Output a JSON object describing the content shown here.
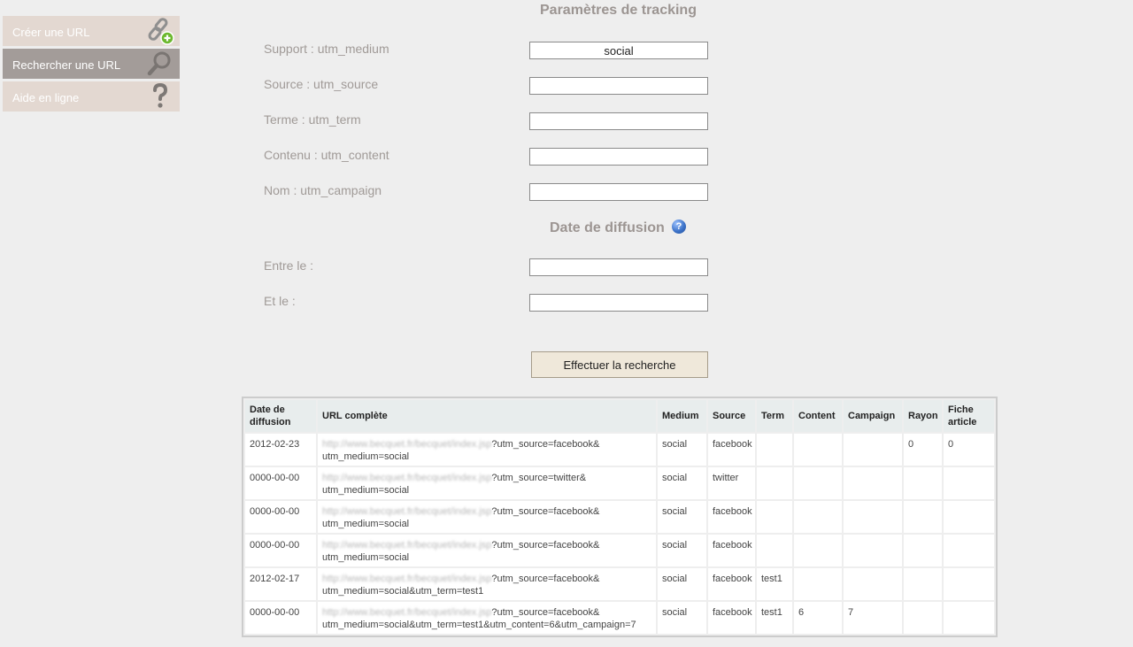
{
  "sidebar": {
    "items": [
      {
        "label": "Créer une URL",
        "icon": "link-add-icon"
      },
      {
        "label": "Rechercher une URL",
        "icon": "magnifier-icon"
      },
      {
        "label": "Aide en ligne",
        "icon": "question-icon"
      }
    ]
  },
  "tracking": {
    "title": "Paramètres de tracking",
    "fields": [
      {
        "label": "Support : utm_medium",
        "value": "social"
      },
      {
        "label": "Source : utm_source",
        "value": ""
      },
      {
        "label": "Terme : utm_term",
        "value": ""
      },
      {
        "label": "Contenu : utm_content",
        "value": ""
      },
      {
        "label": "Nom : utm_campaign",
        "value": ""
      }
    ]
  },
  "date": {
    "title": "Date de diffusion",
    "help_symbol": "?",
    "fields": [
      {
        "label": "Entre le :",
        "value": ""
      },
      {
        "label": "Et le :",
        "value": ""
      }
    ]
  },
  "search_button": "Effectuer la recherche",
  "table": {
    "headers": [
      "Date de diffusion",
      "URL complète",
      "Medium",
      "Source",
      "Term",
      "Content",
      "Campaign",
      "Rayon",
      "Fiche article"
    ],
    "rows": [
      {
        "date": "2012-02-23",
        "url_host": "http://www.becquet.fr/becquet/index.jsp",
        "url_query": "?utm_source=facebook&",
        "url_line2": "utm_medium=social",
        "medium": "social",
        "source": "facebook",
        "term": "",
        "content": "",
        "campaign": "",
        "rayon": "0",
        "fiche": "0"
      },
      {
        "date": "0000-00-00",
        "url_host": "http://www.becquet.fr/becquet/index.jsp",
        "url_query": "?utm_source=twitter&",
        "url_line2": "utm_medium=social",
        "medium": "social",
        "source": "twitter",
        "term": "",
        "content": "",
        "campaign": "",
        "rayon": "",
        "fiche": ""
      },
      {
        "date": "0000-00-00",
        "url_host": "http://www.becquet.fr/becquet/index.jsp",
        "url_query": "?utm_source=facebook&",
        "url_line2": "utm_medium=social",
        "medium": "social",
        "source": "facebook",
        "term": "",
        "content": "",
        "campaign": "",
        "rayon": "",
        "fiche": ""
      },
      {
        "date": "0000-00-00",
        "url_host": "http://www.becquet.fr/becquet/index.jsp",
        "url_query": "?utm_source=facebook&",
        "url_line2": "utm_medium=social",
        "medium": "social",
        "source": "facebook",
        "term": "",
        "content": "",
        "campaign": "",
        "rayon": "",
        "fiche": ""
      },
      {
        "date": "2012-02-17",
        "url_host": "http://www.becquet.fr/becquet/index.jsp",
        "url_query": "?utm_source=facebook&",
        "url_line2": "utm_medium=social&utm_term=test1",
        "medium": "social",
        "source": "facebook",
        "term": "test1",
        "content": "",
        "campaign": "",
        "rayon": "",
        "fiche": ""
      },
      {
        "date": "0000-00-00",
        "url_host": "http://www.becquet.fr/becquet/index.jsp",
        "url_query": "?utm_source=facebook&",
        "url_line2": "utm_medium=social&utm_term=test1&utm_content=6&utm_campaign=7",
        "medium": "social",
        "source": "facebook",
        "term": "test1",
        "content": "6",
        "campaign": "7",
        "rayon": "",
        "fiche": ""
      }
    ]
  }
}
